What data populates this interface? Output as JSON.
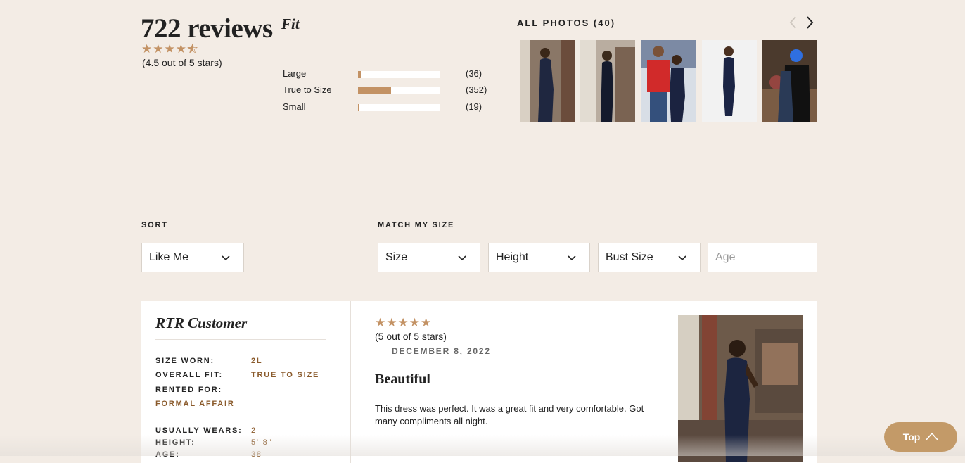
{
  "summary": {
    "reviews_count": "722 reviews",
    "stars": "★★★★",
    "half_star": "★",
    "rating_text": "(4.5 out of 5 stars)"
  },
  "fit": {
    "title": "Fit",
    "rows": [
      {
        "label": "Large",
        "count": "(36)",
        "fill_fraction": 0.03
      },
      {
        "label": "True to Size",
        "count": "(352)",
        "fill_fraction": 0.4
      },
      {
        "label": "Small",
        "count": "(19)",
        "fill_fraction": 0.02
      }
    ]
  },
  "photos": {
    "title": "ALL PHOTOS (40)",
    "thumbnails": [
      {
        "name": "photo-thumbnail-1"
      },
      {
        "name": "photo-thumbnail-2"
      },
      {
        "name": "photo-thumbnail-3"
      },
      {
        "name": "photo-thumbnail-4"
      },
      {
        "name": "photo-thumbnail-5"
      }
    ]
  },
  "sort": {
    "label": "SORT",
    "value": "Like Me"
  },
  "match_size": {
    "label": "MATCH MY SIZE",
    "size": "Size",
    "height": "Height",
    "bust": "Bust Size",
    "age_placeholder": "Age"
  },
  "review": {
    "reviewer": "RTR Customer",
    "stats": {
      "size_worn_k": "SIZE WORN:",
      "size_worn_v": "2L",
      "fit_k": "OVERALL FIT:",
      "fit_v": "TRUE TO SIZE",
      "rented_k": "RENTED FOR:",
      "rented_v": "FORMAL AFFAIR",
      "usually_k": "USUALLY WEARS:",
      "usually_v": "2",
      "height_k": "HEIGHT:",
      "height_v": "5' 8\"",
      "age_k": "AGE:",
      "age_v": "38"
    },
    "stars": "★★★★★",
    "rating_text": "(5 out of 5 stars)",
    "date": "DECEMBER 8, 2022",
    "title": "Beautiful",
    "body": "This dress was perfect. It was a great fit and very comfortable. Got many compliments all night."
  },
  "top_button": {
    "label": "Top"
  },
  "colors": {
    "accent": "#c39264",
    "brown_text": "#8a5a2b",
    "background": "#f3ece5"
  },
  "icons": [
    "chevron-left-icon",
    "chevron-right-icon",
    "chevron-down-icon",
    "chevron-up-icon",
    "star-icon"
  ]
}
